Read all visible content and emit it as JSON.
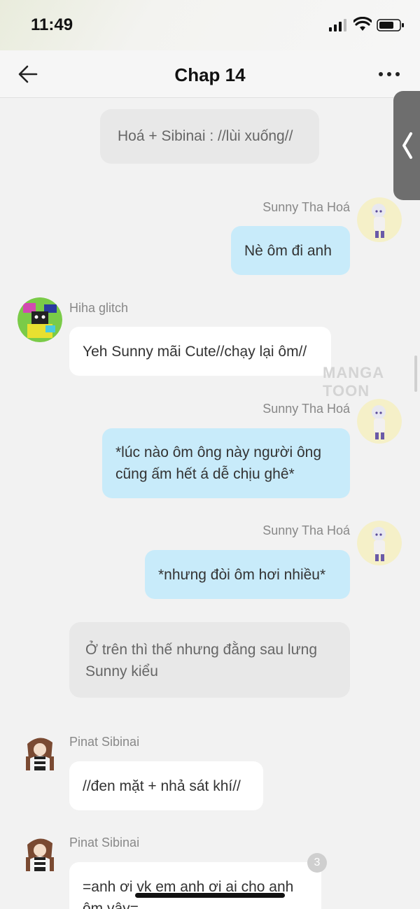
{
  "status": {
    "time": "11:49"
  },
  "nav": {
    "title": "Chap 14"
  },
  "watermark": "MANGA TOON",
  "messages": [
    {
      "kind": "narration",
      "text": "Hoá + Sibinai : //lùi xuống//"
    },
    {
      "kind": "me",
      "sender": "Sunny Tha Hoá",
      "text": "Nè ôm đi anh"
    },
    {
      "kind": "other",
      "sender": "Hiha glitch",
      "text": "Yeh Sunny mãi Cute//chạy lại ôm//"
    },
    {
      "kind": "me",
      "sender": "Sunny Tha Hoá",
      "line1": "*lúc nào ôm ông này người ông",
      "line2": "cũng ấm hết á dễ chịu ghê*"
    },
    {
      "kind": "me",
      "sender": "Sunny Tha Hoá",
      "text": "*nhưng đòi ôm hơi nhiều*"
    },
    {
      "kind": "narration",
      "line1": "Ở trên thì thế nhưng đằng sau lưng",
      "line2": "Sunny kiểu"
    },
    {
      "kind": "other",
      "sender": "Pinat Sibinai",
      "text": "//đen mặt + nhả sát khí//"
    },
    {
      "kind": "other",
      "sender": "Pinat Sibinai",
      "line1": "=anh ơi vk em anh ơi ai cho anh",
      "line2": "ôm vậy="
    }
  ],
  "comment_badge": "3",
  "colors": {
    "me_bubble": "#c8ebfa",
    "other_bubble": "#ffffff",
    "narration": "#e8e8e8"
  }
}
